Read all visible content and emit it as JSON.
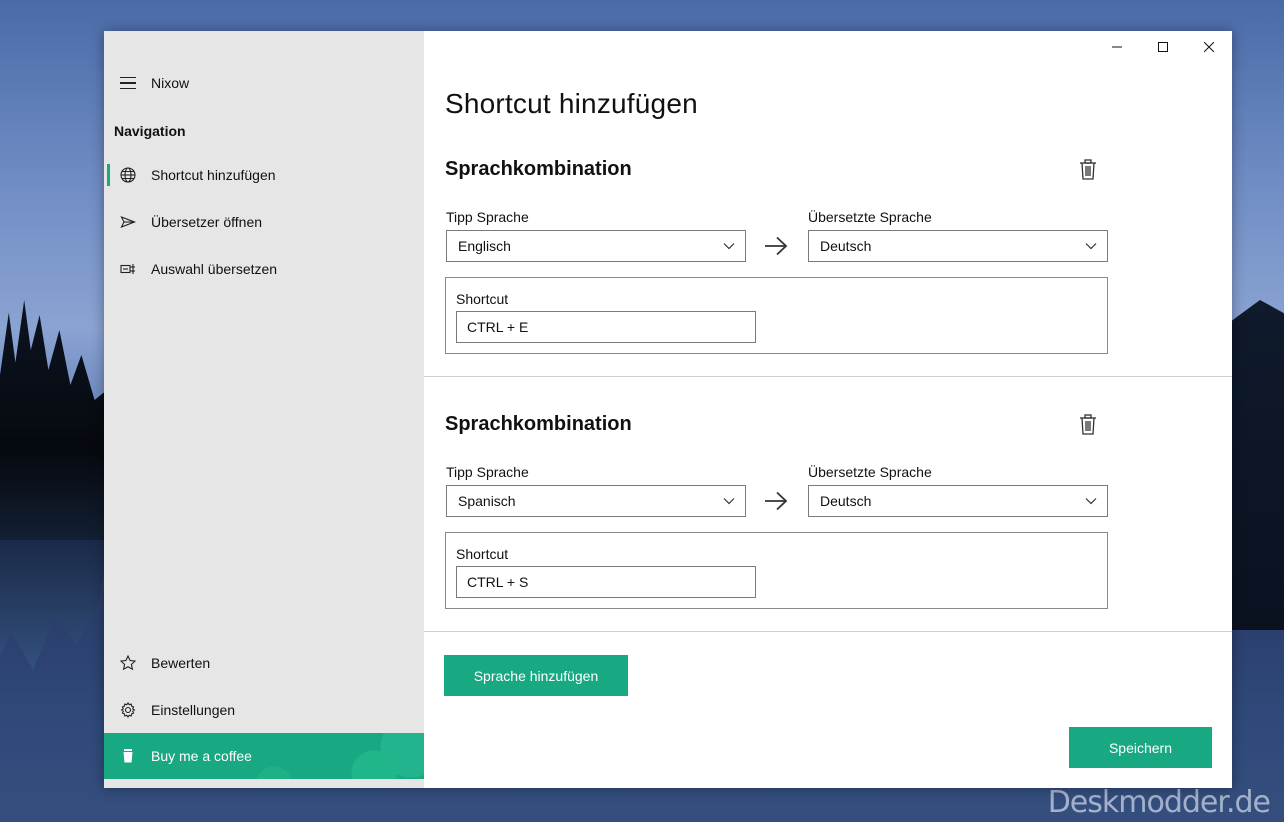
{
  "app": {
    "title": "Nixow"
  },
  "nav": {
    "heading": "Navigation",
    "items": [
      {
        "label": "Shortcut hinzufügen",
        "icon": "globe-icon",
        "active": true
      },
      {
        "label": "Übersetzer öffnen",
        "icon": "send-icon"
      },
      {
        "label": "Auswahl übersetzen",
        "icon": "translate-selection-icon"
      }
    ],
    "bottom_items": [
      {
        "label": "Bewerten",
        "icon": "star-icon"
      },
      {
        "label": "Einstellungen",
        "icon": "gear-icon"
      },
      {
        "label": "Buy me a coffee",
        "icon": "coffee-cup-icon"
      }
    ]
  },
  "page": {
    "title": "Shortcut hinzufügen"
  },
  "combinations": [
    {
      "title": "Sprachkombination",
      "source_label": "Tipp Sprache",
      "source_value": "Englisch",
      "target_label": "Übersetzte Sprache",
      "target_value": "Deutsch",
      "shortcut_label": "Shortcut",
      "shortcut_value": "CTRL + E"
    },
    {
      "title": "Sprachkombination",
      "source_label": "Tipp Sprache",
      "source_value": "Spanisch",
      "target_label": "Übersetzte Sprache",
      "target_value": "Deutsch",
      "shortcut_label": "Shortcut",
      "shortcut_value": "CTRL + S"
    }
  ],
  "actions": {
    "add_language": "Sprache hinzufügen",
    "save": "Speichern"
  },
  "watermark": "Deskmodder.de",
  "colors": {
    "accent": "#18a882",
    "nav_bg": "#e6e6e6"
  }
}
